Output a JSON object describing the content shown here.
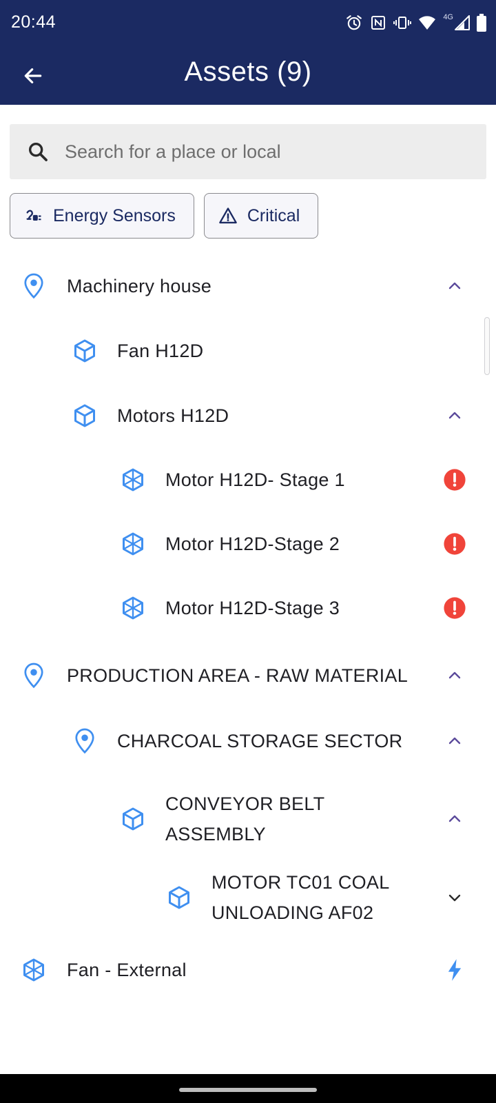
{
  "status_bar": {
    "time": "20:44",
    "network": "4G",
    "icons": [
      "alarm-icon",
      "nfc-icon",
      "vibrate-icon",
      "wifi-icon",
      "signal-icon",
      "battery-icon"
    ]
  },
  "header": {
    "title": "Assets (9)",
    "back_icon": "arrow-left-icon",
    "background": "#1b2a62"
  },
  "search": {
    "value": "",
    "placeholder": "Search for a place or local"
  },
  "filters": [
    {
      "label": "Energy Sensors",
      "icon": "energy-sensor-icon"
    },
    {
      "label": "Critical",
      "icon": "warning-triangle-icon"
    }
  ],
  "tree": [
    {
      "label": "Machinery house",
      "type": "location",
      "trail": "chevron-up"
    },
    {
      "label": "Fan H12D",
      "type": "asset",
      "trail": ""
    },
    {
      "label": "Motors H12D",
      "type": "asset",
      "trail": "chevron-up"
    },
    {
      "label": "Motor H12D- Stage 1",
      "type": "component",
      "trail": "critical"
    },
    {
      "label": "Motor H12D-Stage 2",
      "type": "component",
      "trail": "critical"
    },
    {
      "label": "Motor H12D-Stage 3",
      "type": "component",
      "trail": "critical"
    },
    {
      "label": "PRODUCTION AREA - RAW MATERIAL",
      "type": "location",
      "trail": "chevron-up"
    },
    {
      "label": "CHARCOAL STORAGE SECTOR",
      "type": "location",
      "trail": "chevron-up"
    },
    {
      "label": "CONVEYOR BELT\nASSEMBLY",
      "type": "asset",
      "trail": "chevron-up"
    },
    {
      "label": "MOTOR TC01 COAL\nUNLOADING AF02",
      "type": "asset",
      "trail": "chevron-down"
    },
    {
      "label": "Fan - External",
      "type": "component",
      "trail": "energy"
    }
  ],
  "colors": {
    "accent_blue": "#3f8ff0",
    "chevron": "#5b4a9b",
    "critical": "#f0443a",
    "energy": "#3f8ff0"
  }
}
